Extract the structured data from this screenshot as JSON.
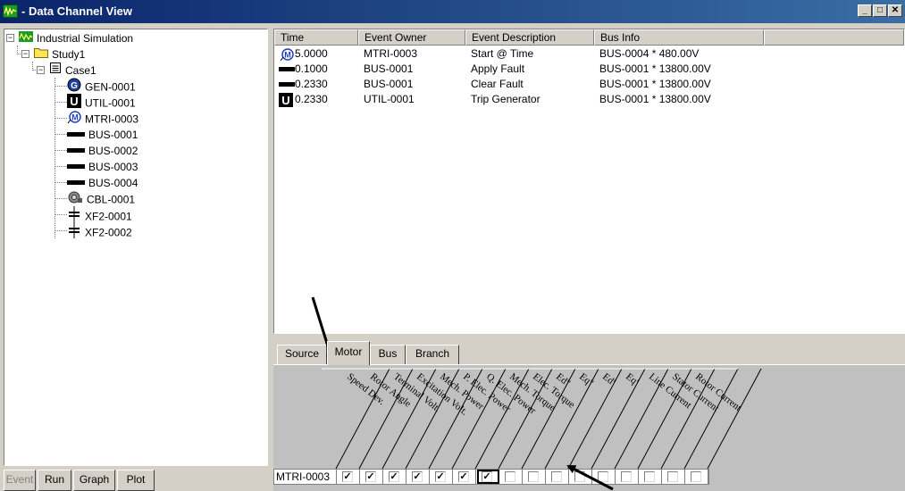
{
  "window": {
    "title": "- Data Channel View",
    "icon": "waveform-app-icon",
    "caption_buttons": [
      "minimize",
      "maximize",
      "close"
    ]
  },
  "tree": {
    "root": {
      "label": "Industrial Simulation",
      "icon": "waveform-icon"
    },
    "study": {
      "label": "Study1",
      "icon": "folder-icon"
    },
    "case": {
      "label": "Case1",
      "icon": "case-icon"
    },
    "items": [
      {
        "label": "GEN-0001",
        "icon": "generator-icon"
      },
      {
        "label": "UTIL-0001",
        "icon": "utility-icon"
      },
      {
        "label": "MTRI-0003",
        "icon": "motor-icon"
      },
      {
        "label": "BUS-0001",
        "icon": "bus-icon"
      },
      {
        "label": "BUS-0002",
        "icon": "bus-icon"
      },
      {
        "label": "BUS-0003",
        "icon": "bus-icon"
      },
      {
        "label": "BUS-0004",
        "icon": "bus-icon"
      },
      {
        "label": "CBL-0001",
        "icon": "cable-icon"
      },
      {
        "label": "XF2-0001",
        "icon": "transformer-icon"
      },
      {
        "label": "XF2-0002",
        "icon": "transformer-icon"
      }
    ]
  },
  "bottom_buttons": [
    {
      "label": "Event",
      "enabled": false
    },
    {
      "label": "Run",
      "enabled": true
    },
    {
      "label": "Graph",
      "enabled": true
    },
    {
      "label": "Plot",
      "enabled": true
    }
  ],
  "events": {
    "columns": [
      "Time",
      "Event Owner",
      "Event Description",
      "Bus Info"
    ],
    "rows": [
      {
        "icon": "motor-icon",
        "time": "5.0000",
        "owner": "MTRI-0003",
        "description": "Start @ Time",
        "bus_info": "BUS-0004 * 480.00V"
      },
      {
        "icon": "bus-icon",
        "time": "0.1000",
        "owner": "BUS-0001",
        "description": "Apply Fault",
        "bus_info": "BUS-0001 * 13800.00V"
      },
      {
        "icon": "bus-icon",
        "time": "0.2330",
        "owner": "BUS-0001",
        "description": "Clear Fault",
        "bus_info": "BUS-0001 * 13800.00V"
      },
      {
        "icon": "utility-icon",
        "time": "0.2330",
        "owner": "UTIL-0001",
        "description": "Trip Generator",
        "bus_info": "BUS-0001 * 13800.00V"
      }
    ]
  },
  "tabs": [
    {
      "label": "Source",
      "active": false
    },
    {
      "label": "Motor",
      "active": true
    },
    {
      "label": "Bus",
      "active": false
    },
    {
      "label": "Branch",
      "active": false
    }
  ],
  "channels": {
    "labels": [
      "Speed Dev.",
      "Rotor Angle",
      "Terminal Volt.",
      "Excitation Volt.",
      "Mech. Power",
      "P. Elec. Power",
      "Q. Elec. Power",
      "Mech. Torque",
      "Elec. Torque",
      "Ed''",
      "Eq''",
      "Ed'",
      "Eq'",
      "Line Current",
      "Stator Current",
      "Rotor Current"
    ],
    "row_label": "MTRI-0003",
    "checked": [
      true,
      true,
      true,
      true,
      true,
      true,
      true,
      false,
      false,
      false,
      false,
      false,
      false,
      false,
      false,
      false
    ],
    "check_glyph": "✓"
  }
}
